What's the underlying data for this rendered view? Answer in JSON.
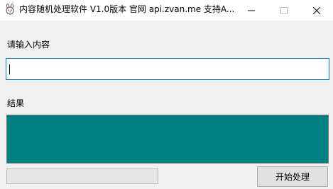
{
  "window": {
    "title": "内容随机处理软件 V1.0版本  官网 api.zvan.me 支持A..."
  },
  "titlebar_buttons": {
    "minimize_icon": "minimize-icon",
    "maximize_icon": "maximize-icon",
    "close_icon": "close-icon"
  },
  "input": {
    "label": "请输入内容",
    "value": "",
    "placeholder": ""
  },
  "result": {
    "label": "结果",
    "value": "",
    "background_color": "#008080"
  },
  "progress": {
    "value": 0
  },
  "actions": {
    "start_label": "开始处理"
  },
  "colors": {
    "focus_border": "#0078d7",
    "result_fill": "#008080"
  }
}
